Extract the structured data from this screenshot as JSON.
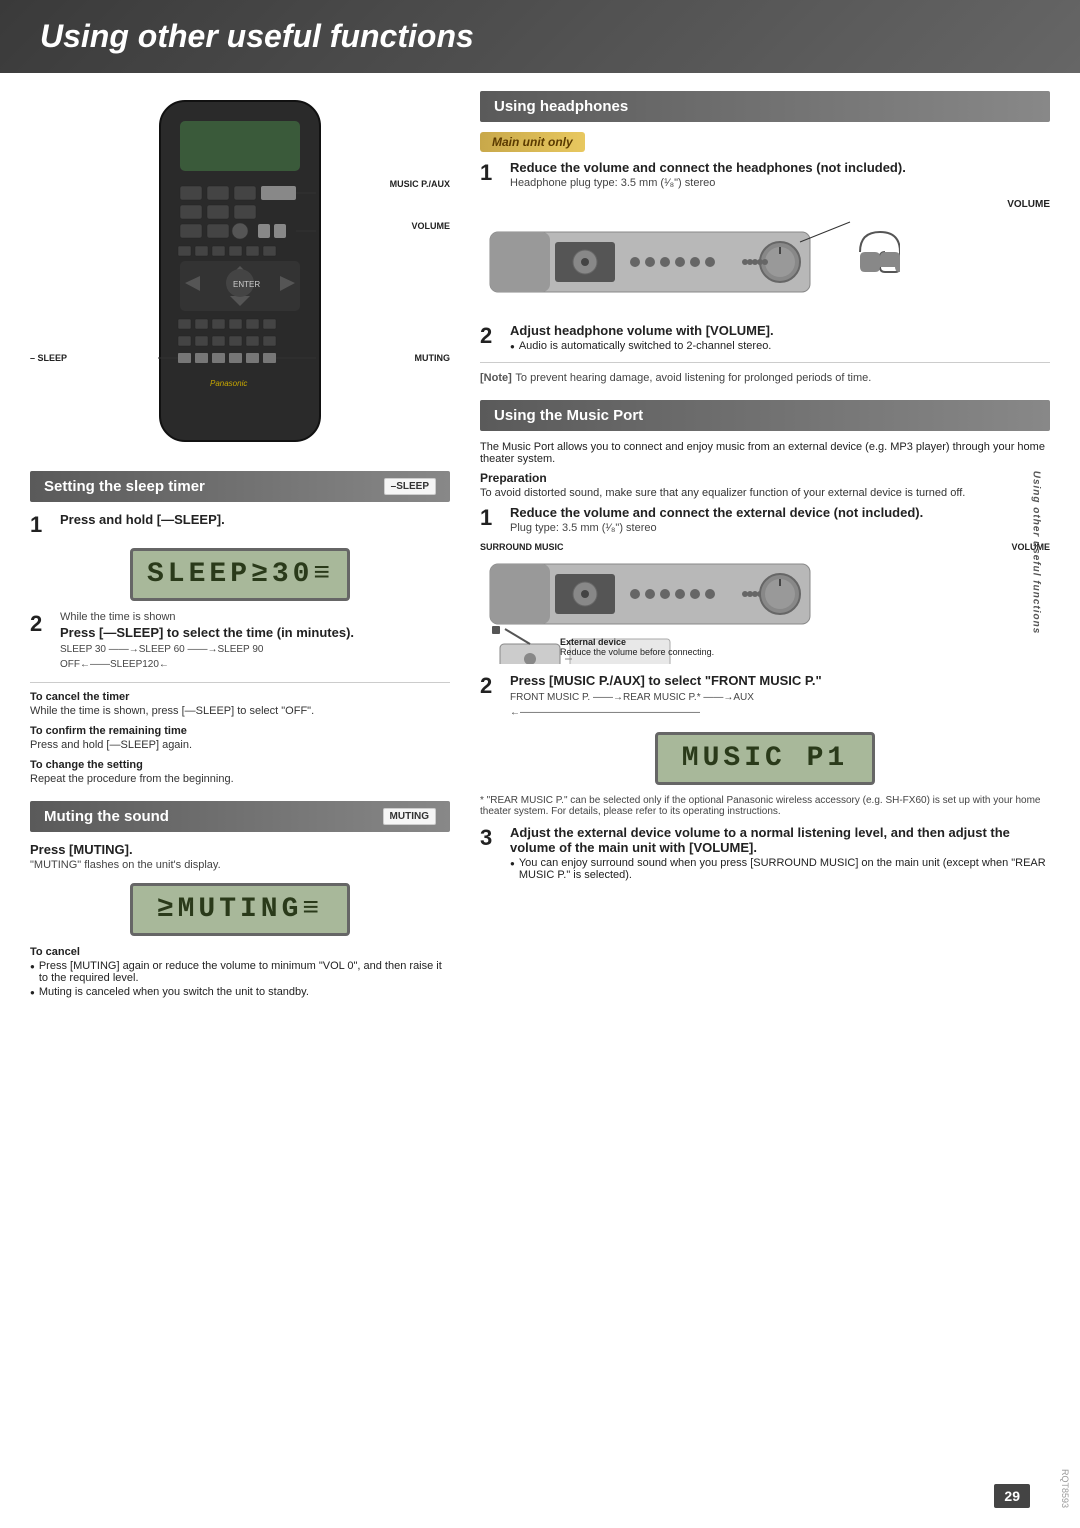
{
  "page": {
    "title": "Using other useful functions",
    "page_number": "29",
    "doc_code": "RQT8593"
  },
  "header": {
    "title": "Using other useful functions"
  },
  "left": {
    "remote_labels": {
      "music_paux": "MUSIC P./AUX",
      "volume": "VOLUME",
      "sleep": "– SLEEP",
      "muting": "MUTING",
      "panasonic": "Panasonic"
    },
    "sleep_section": {
      "title": "Setting the sleep timer",
      "badge_label": "–SLEEP",
      "step1_title": "Press and hold [—SLEEP].",
      "lcd_text": "SLEEP≥30≡",
      "step2_intro": "While the time is shown",
      "step2_title": "Press [—SLEEP] to select the time (in minutes).",
      "chain": "SLEEP 30 ——→SLEEP 60 ——→SLEEP 90",
      "chain2": "OFF←——SLEEP120←",
      "cancel_title": "To cancel the timer",
      "cancel_text": "While the time is shown, press [—SLEEP] to select \"OFF\".",
      "confirm_title": "To confirm the remaining time",
      "confirm_text": "Press and hold [—SLEEP] again.",
      "change_title": "To change the setting",
      "change_text": "Repeat the procedure from the beginning."
    },
    "muting_section": {
      "title": "Muting the sound",
      "badge_label": "MUTING",
      "step1_title": "Press [MUTING].",
      "step1_sub": "\"MUTING\" flashes on the unit's display.",
      "lcd_text": "≥MUTING≡",
      "cancel_title": "To cancel",
      "cancel_bullet1": "Press [MUTING] again or reduce the volume to minimum \"VOL 0\", and then raise it to the required level.",
      "cancel_bullet2": "Muting is canceled when you switch the unit to standby."
    }
  },
  "right": {
    "headphones_section": {
      "title": "Using headphones",
      "badge": "Main unit only",
      "step1_title": "Reduce the volume and connect the headphones (not included).",
      "step1_sub": "Headphone plug type: 3.5 mm (¹⁄₈\") stereo",
      "device_label_volume": "VOLUME",
      "step2_title": "Adjust headphone volume with [VOLUME].",
      "step2_bullet": "Audio is automatically switched to 2-channel stereo.",
      "note_label": "[Note]",
      "note_text": "To prevent hearing damage, avoid listening for prolonged periods of time."
    },
    "music_port_section": {
      "title": "Using the Music Port",
      "intro": "The Music Port allows you to connect and enjoy music from an external device (e.g. MP3 player) through your home theater system.",
      "prep_title": "Preparation",
      "prep_text": "To avoid distorted sound, make sure that any equalizer function of your external device is turned off.",
      "step1_title": "Reduce the volume and connect the external device (not included).",
      "step1_sub": "Plug type: 3.5 mm (¹⁄₈\") stereo",
      "device_label_surround": "SURROUND MUSIC",
      "device_label_volume": "VOLUME",
      "ext_device_title": "External device",
      "ext_device_text": "Reduce the volume before connecting.",
      "step2_title": "Press [MUSIC P./AUX] to select \"FRONT MUSIC P.\"",
      "chain": "FRONT MUSIC P. ——→REAR MUSIC P.* ——→AUX",
      "chain2": "←——————————————————",
      "lcd_music": "MUSIC P1",
      "footnote": "* \"REAR MUSIC P.\" can be selected only if the optional Panasonic wireless accessory (e.g. SH-FX60) is set up with your home theater system. For details, please refer to its operating instructions.",
      "step3_title": "Adjust the external device volume to a normal listening level, and then adjust the volume of the main unit with [VOLUME].",
      "step3_bullet": "You can enjoy surround sound when you press [SURROUND MUSIC] on the main unit (except when \"REAR MUSIC P.\" is selected)."
    },
    "vertical_text": "Using other useful functions"
  }
}
